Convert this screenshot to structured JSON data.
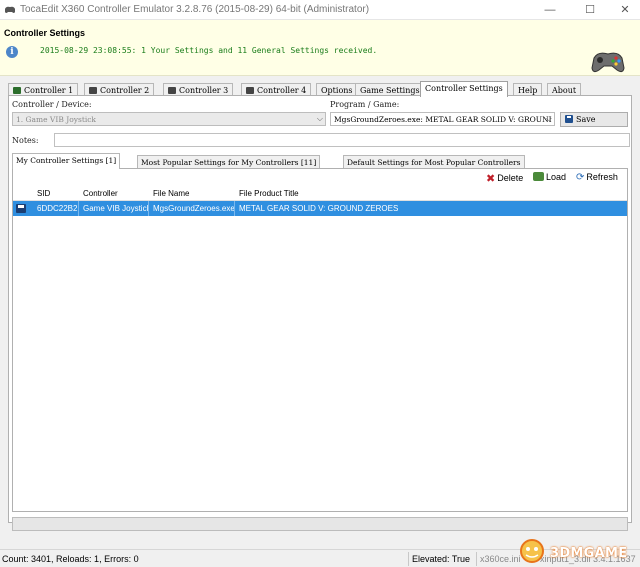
{
  "window": {
    "title": "TocaEdit X360 Controller Emulator 3.2.8.76 (2015-08-29) 64-bit (Administrator)",
    "minimize": "—",
    "maximize": "☐",
    "close": "✕"
  },
  "info": {
    "title": "Controller Settings",
    "message": "2015-08-29 23:08:55: 1 Your Settings and 11 General Settings received."
  },
  "tabs": [
    {
      "label": "Controller 1"
    },
    {
      "label": "Controller 2"
    },
    {
      "label": "Controller 3"
    },
    {
      "label": "Controller 4"
    },
    {
      "label": "Options"
    },
    {
      "label": "Game Settings"
    },
    {
      "label": "Controller Settings"
    },
    {
      "label": "Help"
    },
    {
      "label": "About"
    }
  ],
  "form": {
    "controller_label": "Controller / Device:",
    "controller_value": "1. Game VIB Joystick",
    "program_label": "Program / Game:",
    "program_value": "MgsGroundZeroes.exe: METAL GEAR SOLID V: GROUNI",
    "save_label": "Save",
    "notes_label": "Notes:"
  },
  "subtabs": [
    {
      "label": "My Controller Settings [1]"
    },
    {
      "label": "Most Popular Settings for My Controllers [11]"
    },
    {
      "label": "Default Settings for Most Popular Controllers"
    }
  ],
  "toolbar": {
    "delete_label": "Delete",
    "load_label": "Load",
    "refresh_label": "Refresh"
  },
  "grid": {
    "columns": [
      "SID",
      "Controller",
      "File Name",
      "File Product Title"
    ],
    "rows": [
      {
        "sid": "6DDC22B2",
        "controller": "Game VIB Joystick",
        "file_name": "MgsGroundZeroes.exe",
        "title": "METAL GEAR SOLID V: GROUND ZEROES"
      }
    ]
  },
  "status": {
    "counts": "Count: 3401, Reloads: 1, Errors: 0",
    "elevated": "Elevated: True",
    "ini": "x360ce.ini",
    "xinput": "xinput1_3.dll 3.4.1.1637"
  },
  "watermark": {
    "text": "3DMGAME"
  },
  "colors": {
    "info_bg": "#ffffe6",
    "selected_row": "#2f8fe0",
    "message_green": "#1a7d1a"
  }
}
